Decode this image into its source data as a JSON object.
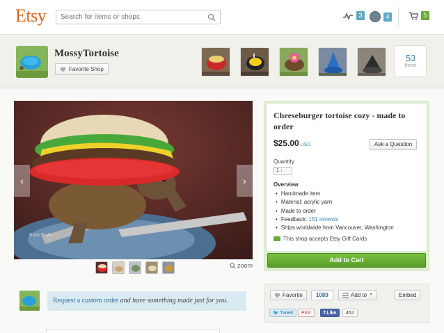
{
  "header": {
    "logo": "Etsy",
    "search_placeholder": "Search for items or shops",
    "activity_count": "3",
    "messages_count": "4",
    "cart_count": "5",
    "badge_blue": "#5fa9c8",
    "badge_green": "#6aa93a"
  },
  "shop": {
    "name": "MossyTortoise",
    "favorite_label": "Favorite Shop",
    "items_count": "53",
    "items_label": "Items"
  },
  "listing": {
    "title": "Cheeseburger tortoise cozy - made to order",
    "price": "$25.00",
    "currency": "USD",
    "ask_label": "Ask a Question",
    "quantity_label": "Quantity",
    "quantity_value": "1",
    "overview_heading": "Overview",
    "overview": [
      "Handmade item",
      "Material: acrylic yarn",
      "Made to order",
      "Ships worldwide from Vancouver, Washington"
    ],
    "feedback_prefix": "Feedback:",
    "feedback_link": "151 reviews",
    "gift_cards": "This shop accepts Etsy Gift Cards",
    "add_to_cart": "Add to Cart",
    "zoom": "zoom",
    "watermark": "Katie Bodin"
  },
  "custom_order": {
    "link": "Request a custom order",
    "text": " and have something made just for you."
  },
  "social": {
    "favorite_label": "Favorite",
    "favorite_count": "1089",
    "add_to_label": "Add to",
    "embed_label": "Embed",
    "tweet": "Tweet",
    "pin": "Pinit",
    "like": "Like",
    "like_count": "452"
  },
  "colors": {
    "accent_orange": "#d5641c",
    "link_blue": "#3a87b8",
    "cart_green": "#6aa93a"
  }
}
